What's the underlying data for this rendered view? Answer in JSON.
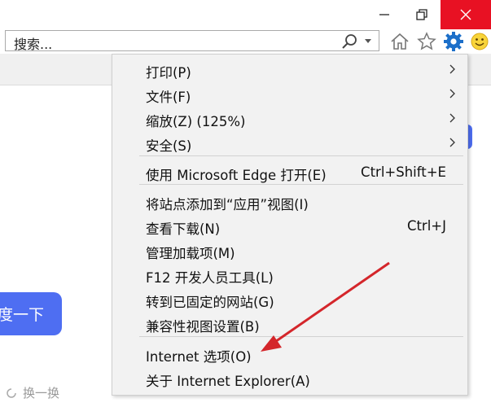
{
  "toolbar": {
    "search_text": "搜索...",
    "icons": [
      "home-icon",
      "star-icon",
      "gear-icon",
      "smiley-icon"
    ]
  },
  "page": {
    "button_label": "度一下",
    "refresh_label": "换一换"
  },
  "menu": {
    "items": [
      {
        "label": "打印(P)",
        "shortcut": "",
        "submenu": true
      },
      {
        "label": "文件(F)",
        "shortcut": "",
        "submenu": true
      },
      {
        "label": "缩放(Z) (125%)",
        "shortcut": "",
        "submenu": true
      },
      {
        "label": "安全(S)",
        "shortcut": "",
        "submenu": true
      },
      {
        "label": "使用 Microsoft Edge 打开(E)",
        "shortcut": "Ctrl+Shift+E",
        "submenu": false
      },
      {
        "label": "将站点添加到“应用”视图(I)",
        "shortcut": "",
        "submenu": false
      },
      {
        "label": "查看下载(N)",
        "shortcut": "Ctrl+J",
        "submenu": false
      },
      {
        "label": "管理加载项(M)",
        "shortcut": "",
        "submenu": false
      },
      {
        "label": "F12 开发人员工具(L)",
        "shortcut": "",
        "submenu": false
      },
      {
        "label": "转到已固定的网站(G)",
        "shortcut": "",
        "submenu": false
      },
      {
        "label": "兼容性视图设置(B)",
        "shortcut": "",
        "submenu": false
      },
      {
        "label": "Internet 选项(O)",
        "shortcut": "",
        "submenu": false
      },
      {
        "label": "关于 Internet Explorer(A)",
        "shortcut": "",
        "submenu": false
      }
    ]
  },
  "colors": {
    "close_red": "#e81123",
    "accent_blue": "#4e6ef2",
    "gear_blue": "#1c6fc9",
    "annotation_red": "#d4262b"
  }
}
